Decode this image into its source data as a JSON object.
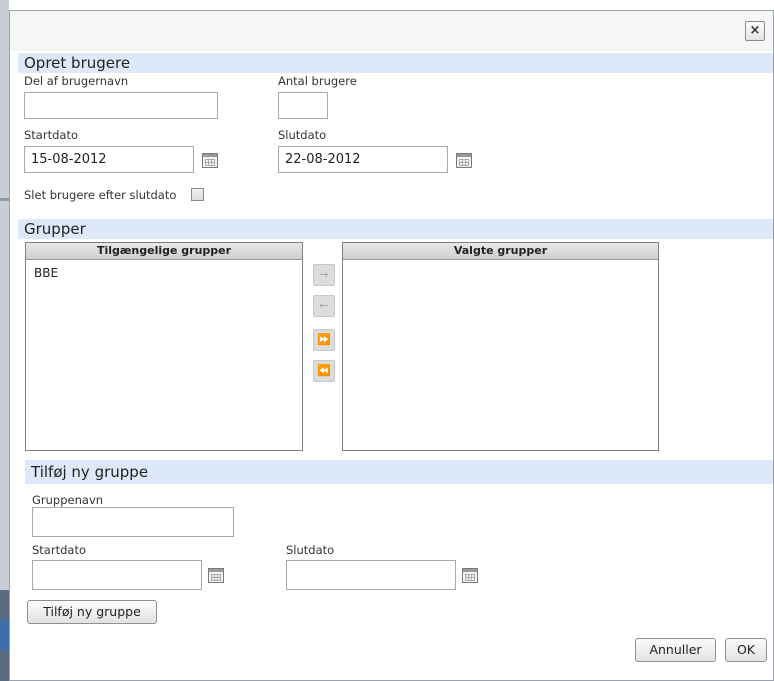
{
  "dialog": {
    "close_icon": "×"
  },
  "opret": {
    "header": "Opret brugere",
    "del_label": "Del af brugernavn",
    "del_value": "",
    "antal_label": "Antal brugere",
    "antal_value": "",
    "startdato_label": "Startdato",
    "startdato_value": "15-08-2012",
    "slutdato_label": "Slutdato",
    "slutdato_value": "22-08-2012",
    "slet_label": "Slet brugere efter slutdato"
  },
  "grupper": {
    "header": "Grupper",
    "available_header": "Tilgængelige grupper",
    "available_items": [
      "BBE"
    ],
    "selected_header": "Valgte grupper",
    "selected_items": [],
    "move_right_icon": "→",
    "move_left_icon": "←",
    "move_all_right_icon": "⏩",
    "move_all_left_icon": "⏪"
  },
  "ny_gruppe": {
    "header": "Tilføj ny gruppe",
    "gruppenavn_label": "Gruppenavn",
    "gruppenavn_value": "",
    "startdato_label": "Startdato",
    "startdato_value": "",
    "slutdato_label": "Slutdato",
    "slutdato_value": "",
    "add_button": "Tilføj ny gruppe"
  },
  "footer": {
    "cancel_button": "Annuller",
    "ok_button": "OK"
  }
}
